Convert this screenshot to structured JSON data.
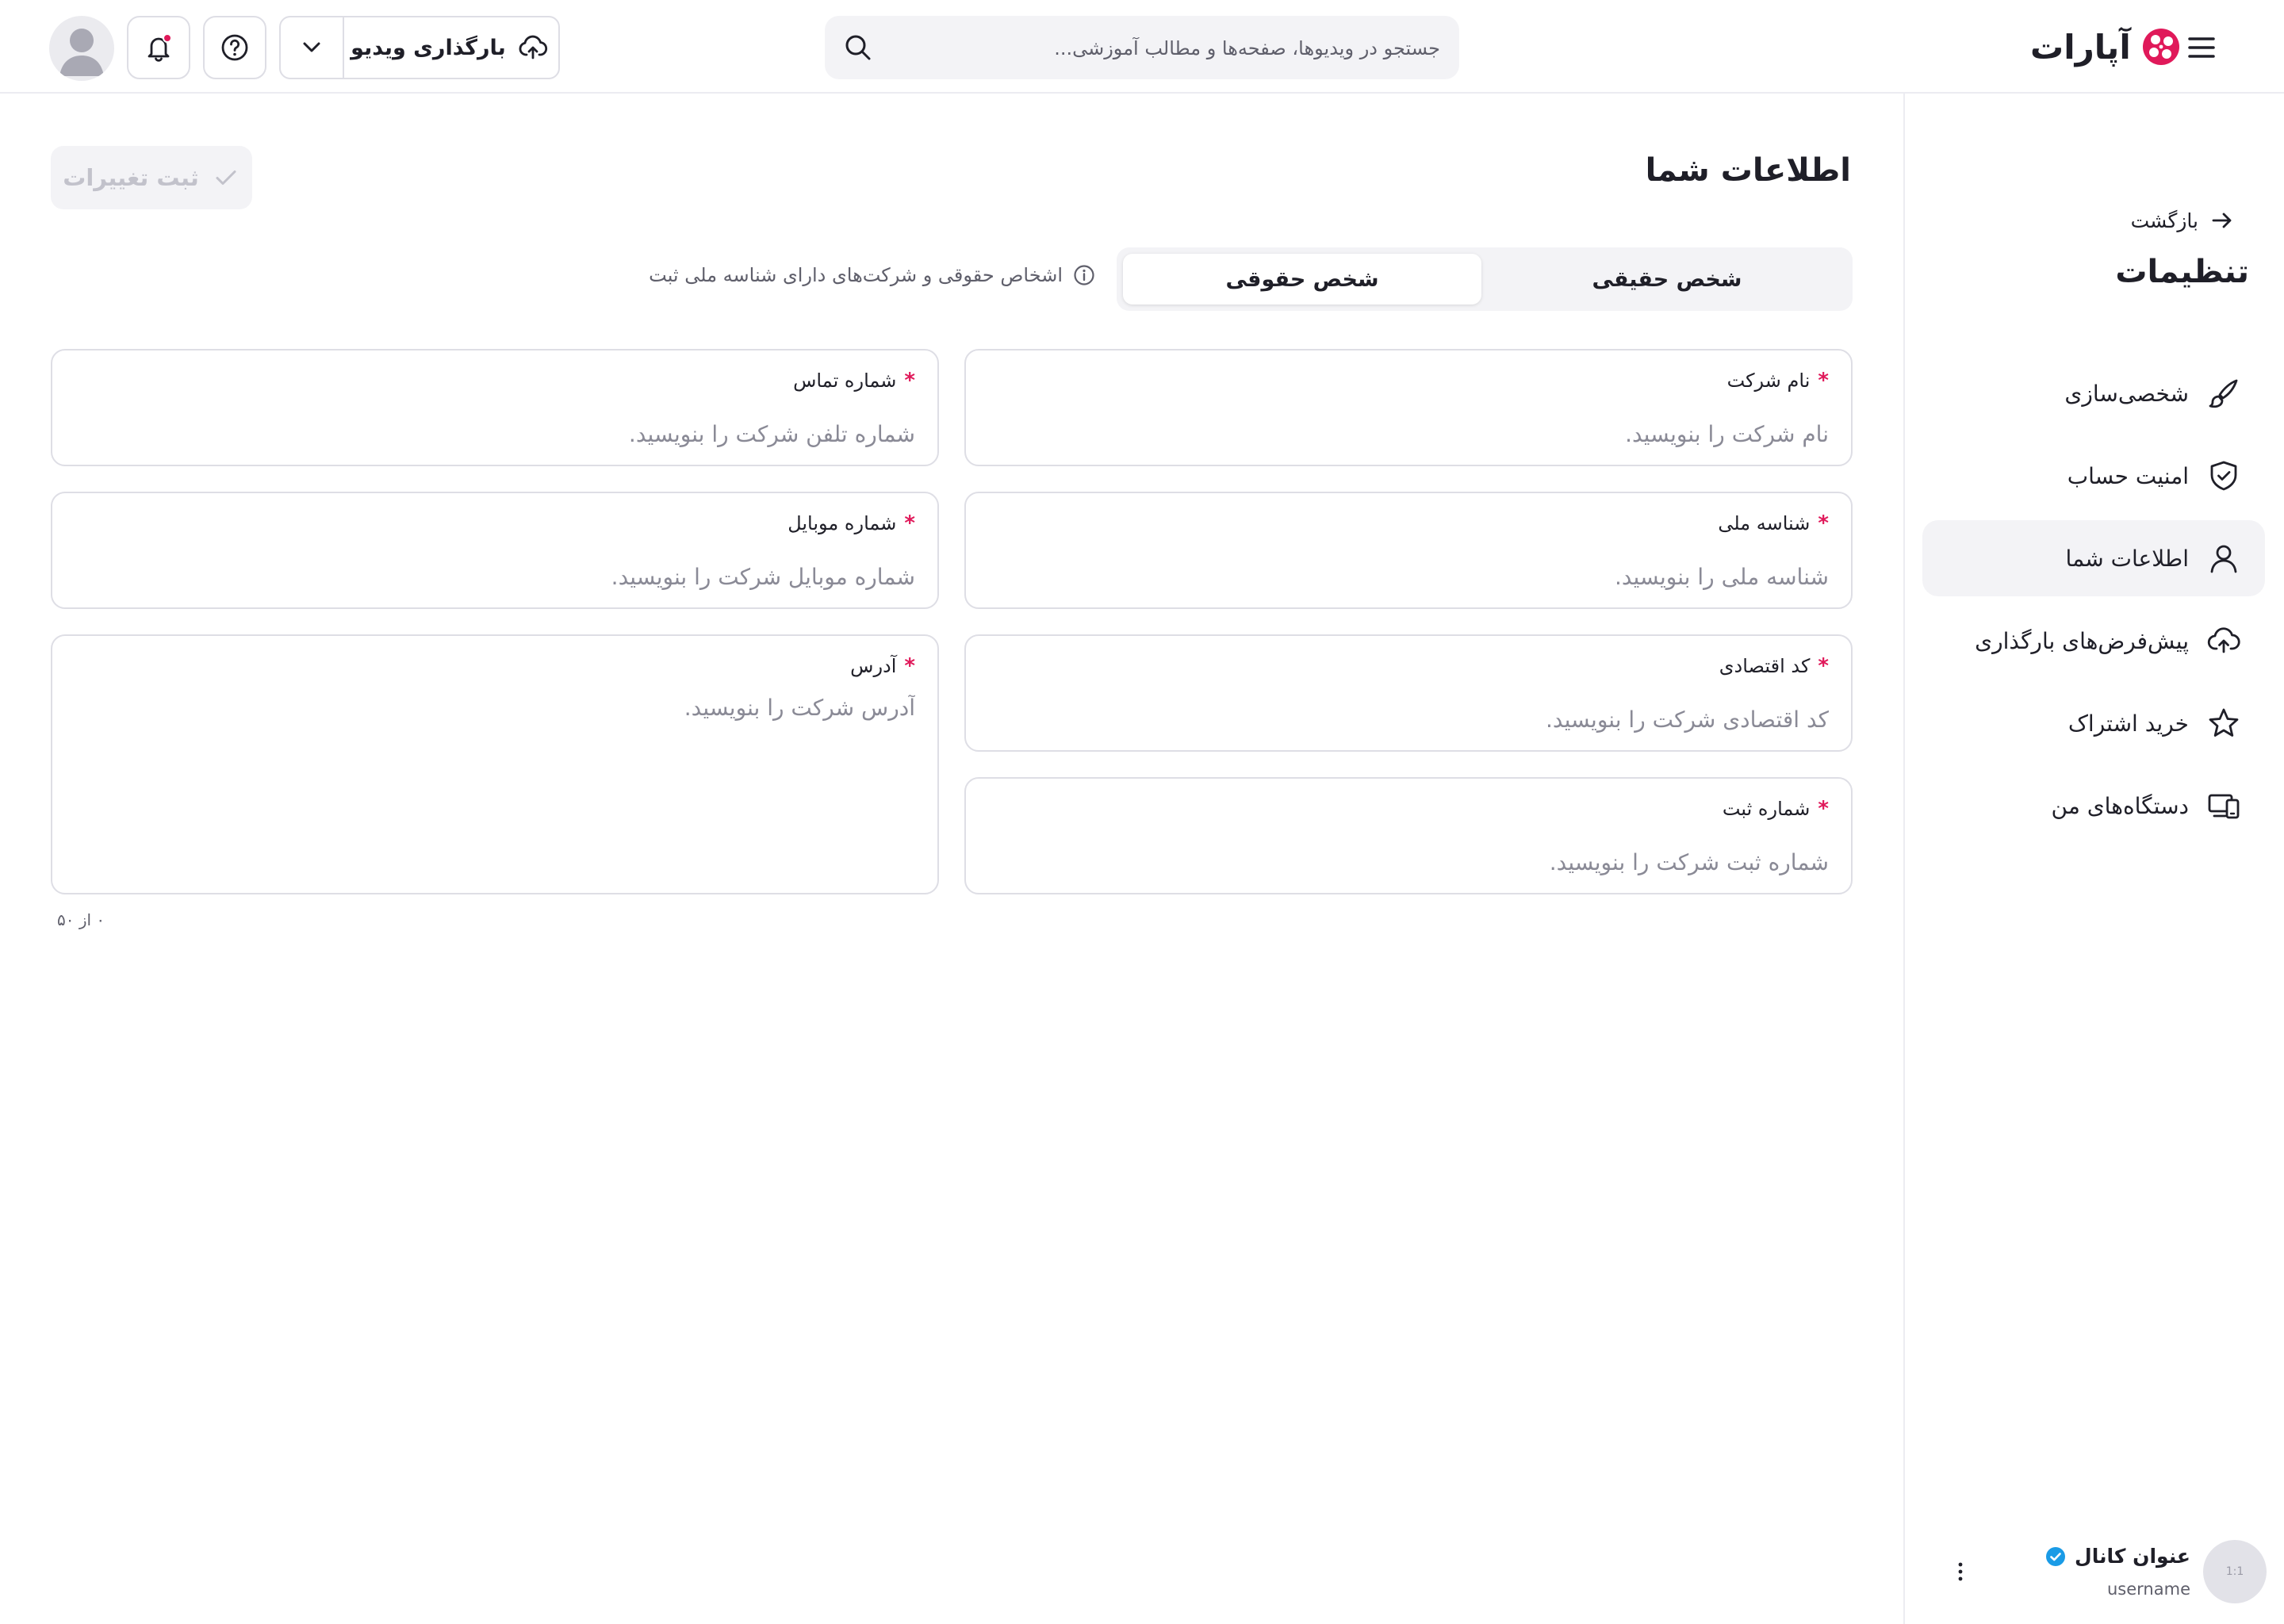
{
  "header": {
    "logo_text": "آپارات",
    "search_placeholder": "جستجو در ویدیوها، صفحه‌ها و مطالب آموزشی...",
    "upload_label": "بارگذاری ویدیو"
  },
  "sidebar": {
    "back_label": "بازگشت",
    "title": "تنظیمات",
    "items": [
      {
        "label": "شخصی‌سازی",
        "icon": "brush-icon"
      },
      {
        "label": "امنیت حساب",
        "icon": "shield-check-icon"
      },
      {
        "label": "اطلاعات شما",
        "icon": "user-icon",
        "active": true
      },
      {
        "label": "پیش‌فرض‌های بارگذاری",
        "icon": "cloud-upload-icon"
      },
      {
        "label": "خرید اشتراک",
        "icon": "star-icon"
      },
      {
        "label": "دستگاه‌های من",
        "icon": "devices-icon"
      }
    ],
    "channel": {
      "avatar_text": "1:1",
      "name": "عنوان کانال",
      "username": "username"
    }
  },
  "main": {
    "title": "اطلاعات شما",
    "save_label": "ثبت تغییرات",
    "tabs": [
      {
        "label": "شخص حقیقی",
        "selected": false
      },
      {
        "label": "شخص حقوقی",
        "selected": true
      }
    ],
    "info_text": "اشخاص حقوقی و شرکت‌های دارای شناسه ملی ثبت",
    "required_mark": "*",
    "fields": {
      "company_name": {
        "label": "نام شرکت",
        "placeholder": "نام شرکت را بنویسید."
      },
      "phone": {
        "label": "شماره تماس",
        "placeholder": "شماره تلفن شرکت را بنویسید."
      },
      "national_id": {
        "label": "شناسه ملی",
        "placeholder": "شناسه ملی را بنویسید."
      },
      "mobile": {
        "label": "شماره موبایل",
        "placeholder": "شماره موبایل شرکت را بنویسید."
      },
      "economic_code": {
        "label": "کد اقتصادی",
        "placeholder": "کد اقتصادی شرکت را بنویسید."
      },
      "address": {
        "label": "آدرس",
        "placeholder": "آدرس شرکت را بنویسید."
      },
      "registration_number": {
        "label": "شماره ثبت",
        "placeholder": "شماره ثبت شرکت را بنویسید."
      }
    },
    "address_counter": "۰ از ۵۰"
  },
  "colors": {
    "brand": "#e0195a",
    "verified": "#1a9be6",
    "border": "#dedee5",
    "surface": "#f3f3f6"
  }
}
